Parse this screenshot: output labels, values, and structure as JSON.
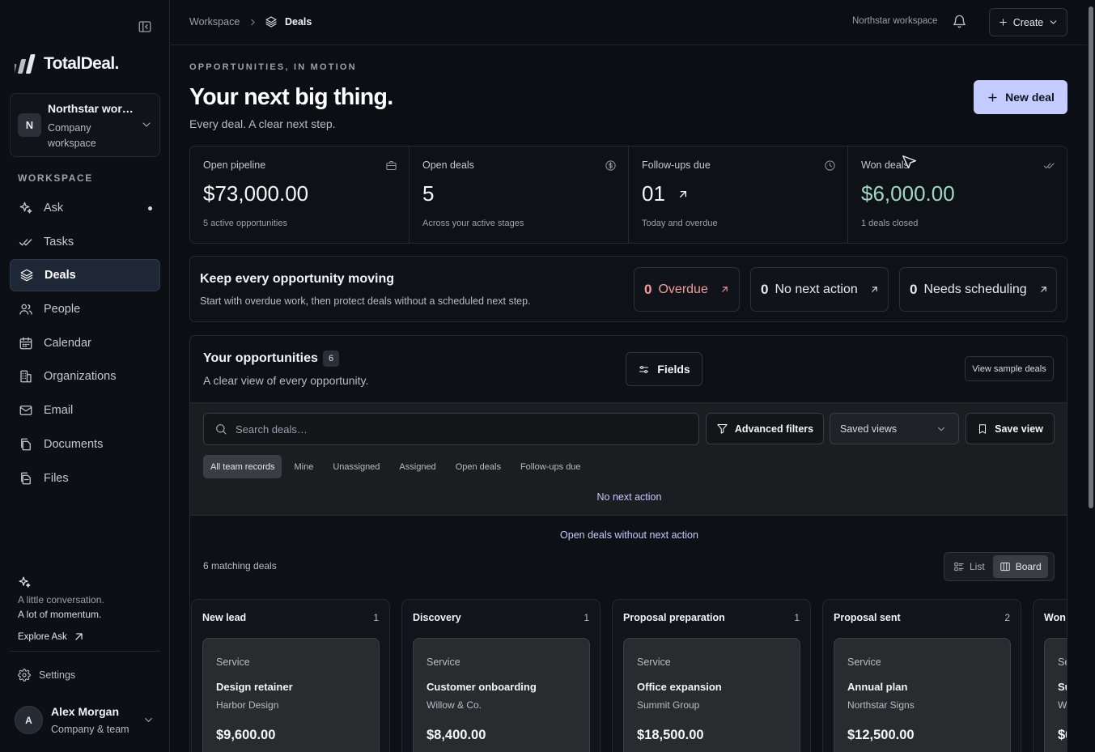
{
  "brand": {
    "name": "TotalDeal."
  },
  "workspace_switcher": {
    "initial": "N",
    "name": "Northstar wor…",
    "subtitle": "Company workspace"
  },
  "sidebar": {
    "section_label": "WORKSPACE",
    "items": [
      {
        "label": "Ask",
        "icon": "sparkle-icon"
      },
      {
        "label": "Tasks",
        "icon": "double-check-icon"
      },
      {
        "label": "Deals",
        "icon": "layers-icon",
        "active": true
      },
      {
        "label": "People",
        "icon": "users-icon"
      },
      {
        "label": "Calendar",
        "icon": "calendar-icon"
      },
      {
        "label": "Organizations",
        "icon": "building-icon"
      },
      {
        "label": "Email",
        "icon": "mail-icon"
      },
      {
        "label": "Documents",
        "icon": "documents-icon"
      },
      {
        "label": "Files",
        "icon": "files-icon"
      }
    ],
    "promo": {
      "line1": "A little conversation.",
      "line2": "A lot of momentum.",
      "link": "Explore Ask"
    },
    "settings_label": "Settings",
    "user": {
      "initial": "A",
      "name": "Alex Morgan",
      "subtitle": "Company & team"
    }
  },
  "topbar": {
    "breadcrumb_root": "Workspace",
    "breadcrumb_current": "Deals",
    "workspace_name": "Northstar workspace",
    "create_label": "Create"
  },
  "header": {
    "eyebrow": "OPPORTUNITIES, IN MOTION",
    "title": "Your next big thing.",
    "subtitle": "Every deal. A clear next step.",
    "new_deal_label": "New deal"
  },
  "stats": [
    {
      "label": "Open pipeline",
      "value": "$73,000.00",
      "note": "5 active opportunities",
      "icon": "briefcase-icon"
    },
    {
      "label": "Open deals",
      "value": "5",
      "note": "Across your active stages",
      "icon": "dollar-circle-icon"
    },
    {
      "label": "Follow-ups due",
      "value": "01",
      "note": "Today and overdue",
      "icon": "clock-icon"
    },
    {
      "label": "Won deals",
      "value": "$6,000.00",
      "note": "1 deals closed",
      "icon": "double-check-icon"
    }
  ],
  "momentum": {
    "title": "Keep every opportunity moving",
    "subtitle": "Start with overdue work, then protect deals without a scheduled next step.",
    "chips": [
      {
        "count": "0",
        "label": "Overdue"
      },
      {
        "count": "0",
        "label": "No next action"
      },
      {
        "count": "0",
        "label": "Needs scheduling"
      }
    ]
  },
  "opportunities": {
    "title": "Your opportunities",
    "count": "6",
    "subtitle": "A clear view of every opportunity.",
    "fields_label": "Fields",
    "sample_label": "View sample deals",
    "search_placeholder": "Search deals…",
    "advanced_filters_label": "Advanced filters",
    "saved_views_label": "Saved views",
    "save_view_label": "Save view",
    "filters": [
      "All team records",
      "Mine",
      "Unassigned",
      "Assigned",
      "Open deals",
      "Follow-ups due"
    ],
    "active_filter_note": "No next action",
    "open_link": "Open deals without next action",
    "matching": "6 matching deals",
    "view_toggle": {
      "list": "List",
      "board": "Board"
    }
  },
  "board": {
    "columns": [
      {
        "title": "New lead",
        "count": "1",
        "card": {
          "type": "Service",
          "title": "Design retainer",
          "org": "Harbor Design",
          "amount": "$9,600.00"
        }
      },
      {
        "title": "Discovery",
        "count": "1",
        "card": {
          "type": "Service",
          "title": "Customer onboarding",
          "org": "Willow & Co.",
          "amount": "$8,400.00"
        }
      },
      {
        "title": "Proposal preparation",
        "count": "1",
        "card": {
          "type": "Service",
          "title": "Office expansion",
          "org": "Summit Group",
          "amount": "$18,500.00"
        }
      },
      {
        "title": "Proposal sent",
        "count": "2",
        "card": {
          "type": "Service",
          "title": "Annual plan",
          "org": "Northstar Signs",
          "amount": "$12,500.00"
        }
      },
      {
        "title": "Won",
        "count": "",
        "card": {
          "type": "Se",
          "title": "Su",
          "org": "W",
          "amount": "$6"
        }
      }
    ]
  },
  "colors": {
    "accent": "#c3cbff",
    "won": "#9fd7c2",
    "overdue": "#f29b9b",
    "background": "#0b0e13"
  }
}
